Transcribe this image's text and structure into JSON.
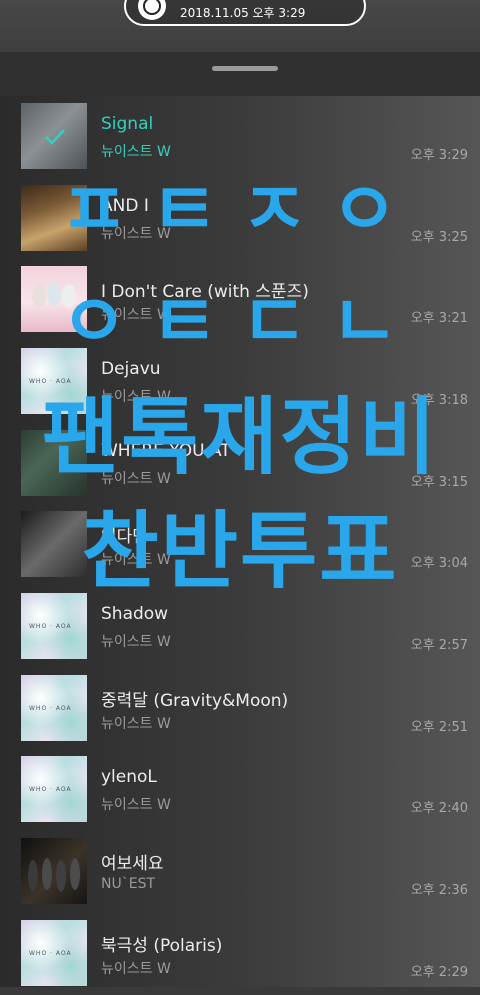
{
  "status": {
    "timestamp": "2018.11.05 오후 3:29",
    "icon": "disc-icon"
  },
  "playlist": {
    "items": [
      {
        "title": "Signal",
        "artist": "뉴이스트 W",
        "time": "오후 3:29",
        "art": "grey",
        "active": true
      },
      {
        "title": "AND I",
        "artist": "뉴이스트 W",
        "time": "오후 3:25",
        "art": "brown",
        "active": false
      },
      {
        "title": "I Don't Care (with 스푼즈)",
        "artist": "뉴이스트 W",
        "time": "오후 3:21",
        "art": "pink",
        "active": false
      },
      {
        "title": "Dejavu",
        "artist": "뉴이스트 W",
        "time": "오후 3:18",
        "art": "pastel",
        "active": false
      },
      {
        "title": "WHERE YOU AT",
        "artist": "뉴이스트 W",
        "time": "오후 3:15",
        "art": "green",
        "active": false
      },
      {
        "title": "있다면",
        "artist": "뉴이스트 W",
        "time": "오후 3:04",
        "art": "bw",
        "active": false
      },
      {
        "title": "Shadow",
        "artist": "뉴이스트 W",
        "time": "오후 2:57",
        "art": "pastel",
        "active": false
      },
      {
        "title": "중력달 (Gravity&Moon)",
        "artist": "뉴이스트 W",
        "time": "오후 2:51",
        "art": "pastel",
        "active": false
      },
      {
        "title": "ylenoL",
        "artist": "뉴이스트 W",
        "time": "오후 2:40",
        "art": "pastel",
        "active": false
      },
      {
        "title": "여보세요",
        "artist": "NU`EST",
        "time": "오후 2:36",
        "art": "dark",
        "active": false
      },
      {
        "title": "북극성 (Polaris)",
        "artist": "뉴이스트 W",
        "time": "오후 2:29",
        "art": "pastel",
        "active": false
      }
    ]
  },
  "overlay": {
    "line1": "ㅍㅌㅈㅇ",
    "line2": "ㅇㅌㄷㄴ",
    "line3": "팬톡재정비",
    "line4": "찬반투표",
    "color": "#2aa7ea"
  },
  "colors": {
    "active_accent": "#33d1c0"
  }
}
